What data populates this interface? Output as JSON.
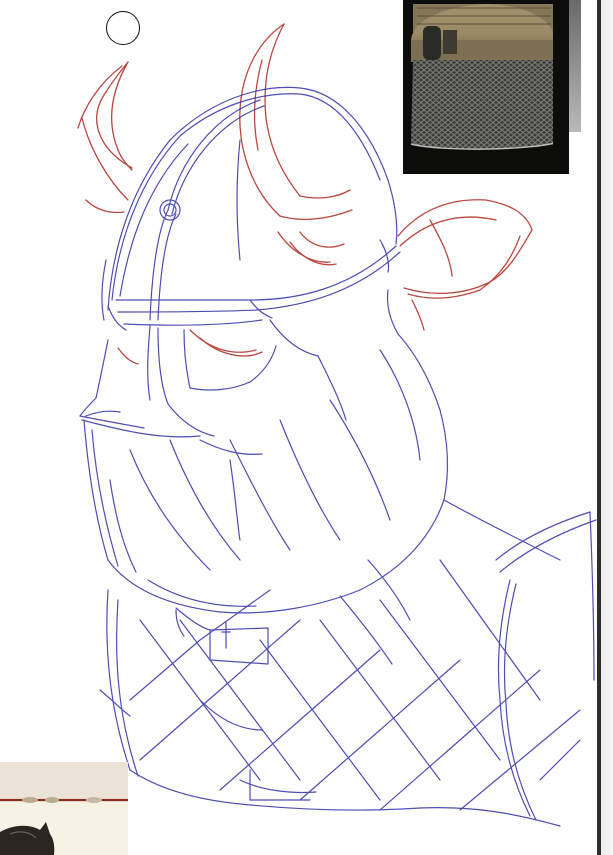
{
  "canvas": {
    "background": "#ffffff",
    "stroke_colors": {
      "sketch": "#2f2fa6",
      "horns_and_ears": "#b2342b"
    }
  },
  "icons": {
    "brush_cursor": "circle-brush-cursor-icon"
  },
  "references": {
    "helmet_photo": "chainmail-helmet-reference-photo",
    "bottom_photo": "horned-helmet-reference-photo"
  }
}
